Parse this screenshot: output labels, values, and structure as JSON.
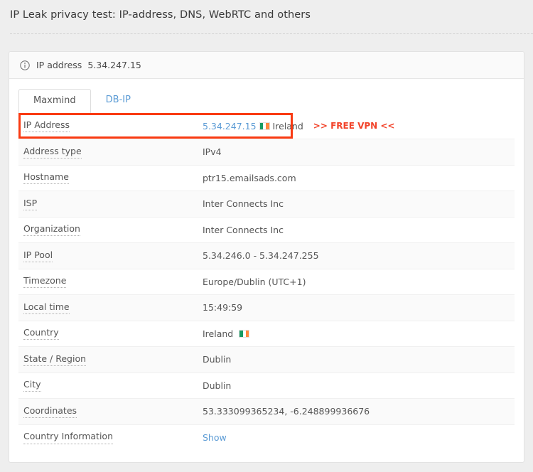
{
  "page": {
    "title": "IP Leak privacy test: IP-address, DNS, WebRTC and others"
  },
  "panel": {
    "header": {
      "icon": "info-circle-icon",
      "label": "IP address",
      "ip": "5.34.247.15"
    },
    "tabs": [
      {
        "label": "Maxmind",
        "active": true
      },
      {
        "label": "DB-IP",
        "active": false
      }
    ],
    "promo": {
      "free_vpn_label": ">> FREE VPN <<",
      "color": "#f2432a"
    },
    "highlight": {
      "color": "#f93a12",
      "target": "ip-address-row"
    },
    "rows": [
      {
        "label": "IP Address",
        "value": "5.34.247.15",
        "value_type": "link",
        "flag": "ireland-flag",
        "country": "Ireland",
        "highlighted": true
      },
      {
        "label": "Address type",
        "value": "IPv4",
        "value_type": "text"
      },
      {
        "label": "Hostname",
        "value": "ptr15.emailsads.com",
        "value_type": "text"
      },
      {
        "label": "ISP",
        "value": "Inter Connects Inc",
        "value_type": "text"
      },
      {
        "label": "Organization",
        "value": "Inter Connects Inc",
        "value_type": "text"
      },
      {
        "label": "IP Pool",
        "value": "5.34.246.0 - 5.34.247.255",
        "value_type": "text"
      },
      {
        "label": "Timezone",
        "value": "Europe/Dublin (UTC+1)",
        "value_type": "text"
      },
      {
        "label": "Local time",
        "value": "15:49:59",
        "value_type": "text"
      },
      {
        "label": "Country",
        "value": "Ireland",
        "value_type": "text",
        "flag": "ireland-flag"
      },
      {
        "label": "State / Region",
        "value": "Dublin",
        "value_type": "text"
      },
      {
        "label": "City",
        "value": "Dublin",
        "value_type": "text"
      },
      {
        "label": "Coordinates",
        "value": "53.333099365234, -6.248899936676",
        "value_type": "text"
      },
      {
        "label": "Country Information",
        "value": "Show",
        "value_type": "link"
      }
    ]
  },
  "colors": {
    "background": "#eeeeee",
    "panel_bg": "#ffffff",
    "panel_header_bg": "#fafafa",
    "link": "#5b9bd5",
    "accent_red": "#f2432a",
    "text": "#555555"
  }
}
